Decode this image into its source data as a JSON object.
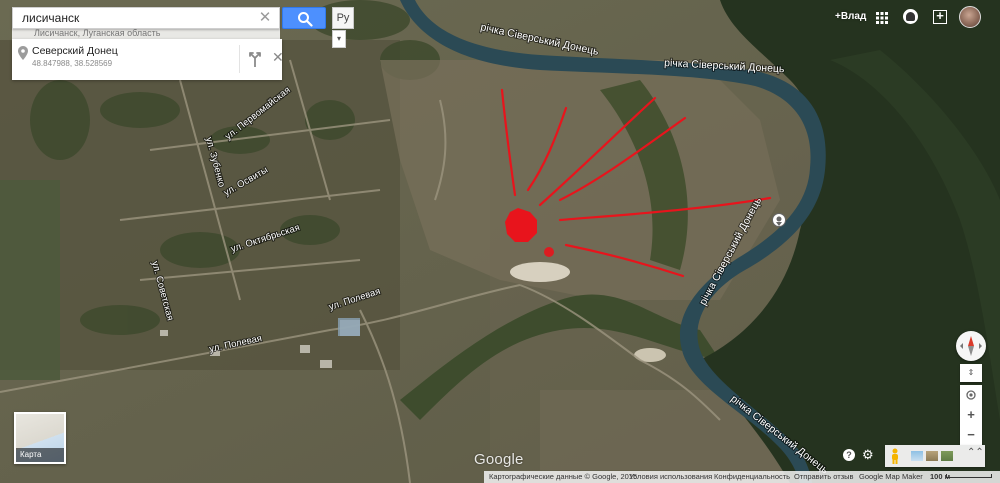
{
  "search": {
    "query": "лисичанск",
    "clear_symbol": "✕",
    "ghost_text": "Лисичанск, Луганская область",
    "lang_label": "Ру",
    "expand_symbol": "▾"
  },
  "place": {
    "name": "Северский Донец",
    "coords": "48.847988, 38.528569",
    "close_symbol": "✕"
  },
  "header": {
    "plus_user": "+Влад",
    "share_symbol": "+"
  },
  "map": {
    "river_labels": [
      "річка Сіверський Донець",
      "річка Сіверський Донець",
      "річка Сіверський Донець",
      "річка Сіверський Донець"
    ],
    "street_labels": [
      "ул. Первомайская",
      "ул. Зубенко",
      "ул. Освиты",
      "ул. Октябрьская",
      "ул. Советская",
      "ул. Полевая",
      "ул. Полевая"
    ],
    "annotation_color": "#e8141c",
    "water_color": "#2b4a55"
  },
  "controls": {
    "tilt_label": "⇕",
    "zoom_in": "+",
    "zoom_out": "−",
    "help_label": "?",
    "settings_symbol": "⚙",
    "chevrons": "⌃⌃"
  },
  "minimap": {
    "label": "Карта"
  },
  "footer": {
    "google_logo": "Google",
    "map_data": "Картографические данные © Google, 2015",
    "terms": "Условия использования",
    "privacy": "Конфиденциальность",
    "feedback": "Отправить отзыв",
    "mapmaker": "Google Map Maker",
    "scale": "100 м"
  }
}
